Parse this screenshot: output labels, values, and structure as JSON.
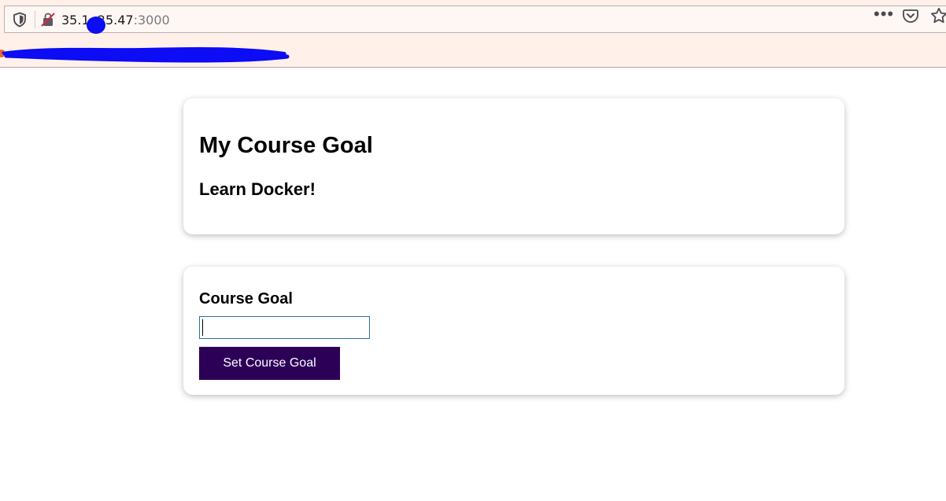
{
  "browser": {
    "url_host": "35.1  .25.47",
    "url_port": ":3000",
    "actions": {
      "more_icon": "ellipsis-icon",
      "pocket_icon": "pocket-icon",
      "bookmark_icon": "star-icon"
    },
    "colors": {
      "chrome_bg": "#fff0ea",
      "redaction": "#0c0cf5"
    }
  },
  "goal_card": {
    "title": "My Course Goal",
    "goal": "Learn Docker!"
  },
  "goal_form": {
    "label": "Course Goal",
    "input_value": "",
    "button_label": "Set Course Goal",
    "button_color": "#2d0058"
  }
}
